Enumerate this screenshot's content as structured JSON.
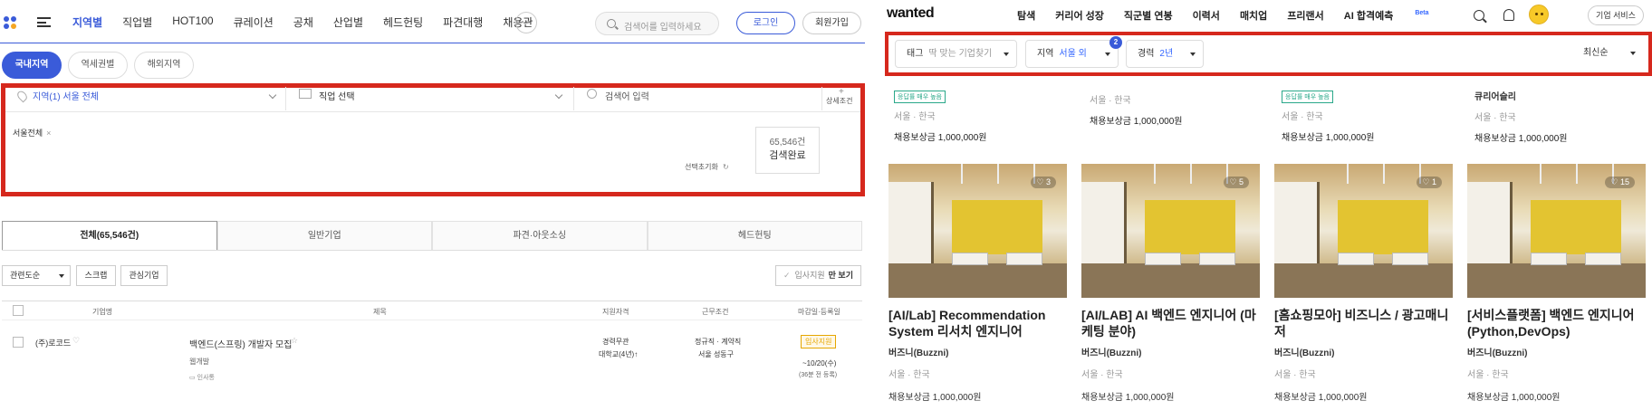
{
  "left": {
    "nav": [
      "지역별",
      "직업별",
      "HOT100",
      "큐레이션",
      "공채",
      "산업별",
      "헤드헌팅",
      "파견대행",
      "채용관"
    ],
    "more": "···",
    "search_placeholder": "검색어를 입력하세요",
    "login": "로그인",
    "join": "회원가입",
    "region_pills": [
      "국내지역",
      "역세권별",
      "해외지역"
    ],
    "filter_region": "지역(1) 서울 전체",
    "filter_job": "직업 선택",
    "filter_keyword": "검색어 입력",
    "detail": "상세조건",
    "selected_tag": "서울전체",
    "tag_close": "×",
    "count": "65,546건",
    "count_done": "검색완료",
    "reset": "선택초기화",
    "tabs": [
      "전체(65,546건)",
      "일반기업",
      "파견·아웃소싱",
      "헤드헌팅"
    ],
    "sort": "관련도순",
    "scrap": "스크랩",
    "interest": "관심기업",
    "apply_label": "입사지원",
    "apply_only": "만 보기",
    "headers": [
      "기업명",
      "제목",
      "지원자격",
      "근무조건",
      "마감일·등록일"
    ],
    "row": {
      "company": "(주)로코드",
      "title": "백엔드(스프링) 개발자 모집",
      "tag": "웹개발",
      "sub": "인사통",
      "qual1": "경력무관",
      "qual2": "대학교(4년)↑",
      "cond1": "정규직 · 계약직",
      "cond2": "서울 성동구",
      "badge": "입사지원",
      "deadline": "~10/20(수)",
      "posted": "(36분 전 등록)"
    }
  },
  "right": {
    "logo": "wanted",
    "nav": [
      "탐색",
      "커리어 성장",
      "직군별 연봉",
      "이력서",
      "매치업",
      "프리랜서",
      "AI 합격예측"
    ],
    "beta": "Beta",
    "corp": "기업 서비스",
    "filter_tag": "태그",
    "filter_tag_hint": "딱 맞는 기업찾기",
    "filter_region": "지역",
    "filter_region_val": "서울 외",
    "region_badge": "2",
    "filter_career": "경력",
    "filter_career_val": "2년",
    "sort": "최신순",
    "top_cards": [
      {
        "company": "",
        "badge": "응답률 매우 높음",
        "loc": "서울 · 한국",
        "reward": "채용보상금 1,000,000원"
      },
      {
        "company": "",
        "badge": "",
        "loc": "서울 · 한국",
        "reward": "채용보상금 1,000,000원"
      },
      {
        "company": "",
        "badge": "응답률 매우 높음",
        "loc": "서울 · 한국",
        "reward": "채용보상금 1,000,000원"
      },
      {
        "company": "큐리어슬리",
        "badge": "",
        "loc": "서울 · 한국",
        "reward": "채용보상금 1,000,000원"
      }
    ],
    "cards": [
      {
        "likes": "♡ 3",
        "title": "[AI/Lab] Recommendation System 리서치 엔지니어",
        "company": "버즈니(Buzzni)",
        "loc": "서울 · 한국",
        "reward": "채용보상금 1,000,000원"
      },
      {
        "likes": "♡ 5",
        "title": "[AI/LAB] AI 백엔드 엔지니어 (마케팅 분야)",
        "company": "버즈니(Buzzni)",
        "loc": "서울 · 한국",
        "reward": "채용보상금 1,000,000원"
      },
      {
        "likes": "♡ 1",
        "title": "[홈쇼핑모아] 비즈니스 / 광고매니저",
        "company": "버즈니(Buzzni)",
        "loc": "서울 · 한국",
        "reward": "채용보상금 1,000,000원"
      },
      {
        "likes": "♡ 15",
        "title": "[서비스플랫폼] 백엔드 엔지니어(Python,DevOps)",
        "company": "버즈니(Buzzni)",
        "loc": "서울 · 한국",
        "reward": "채용보상금 1,000,000원"
      }
    ]
  }
}
